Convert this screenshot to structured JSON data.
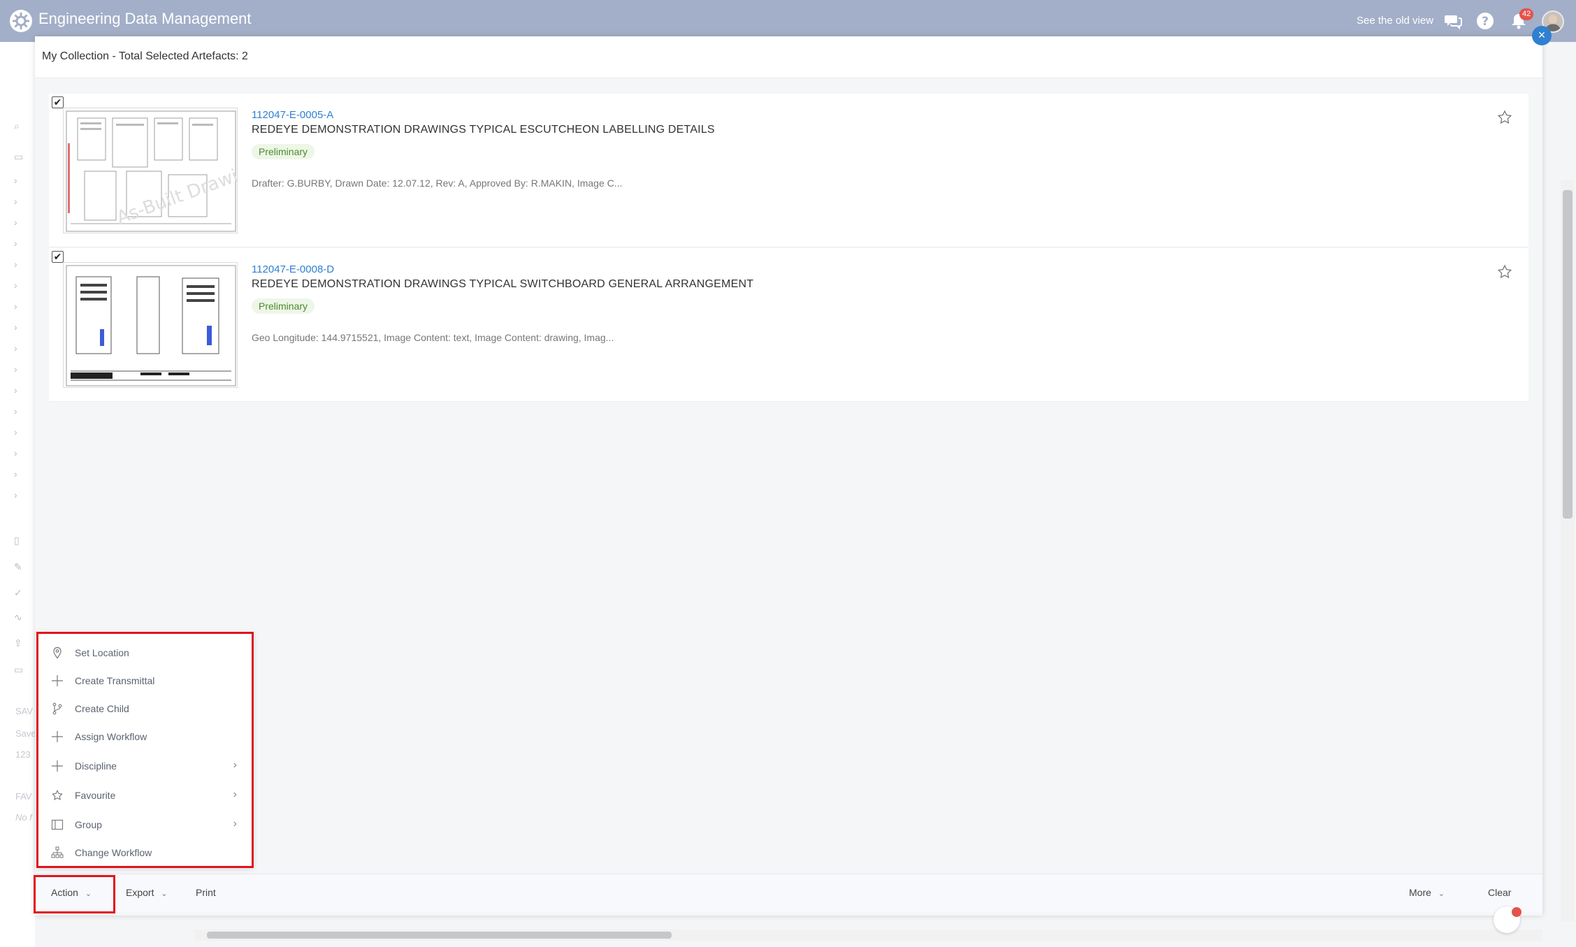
{
  "app": {
    "title": "Engineering Data Management",
    "old_view_link": "See the old view",
    "notification_count": "42"
  },
  "modal": {
    "title": "My Collection - Total Selected Artefacts: 2",
    "close_icon": "close-icon"
  },
  "artefacts": [
    {
      "id": "112047-E-0005-A",
      "title": "REDEYE DEMONSTRATION DRAWINGS TYPICAL ESCUTCHEON LABELLING DETAILS",
      "status": "Preliminary",
      "meta": "Drafter: G.BURBY, Drawn Date: 12.07.12, Rev: A, Approved By: R.MAKIN, Image C...",
      "checked": true
    },
    {
      "id": "112047-E-0008-D",
      "title": "REDEYE DEMONSTRATION DRAWINGS TYPICAL SWITCHBOARD GENERAL ARRANGEMENT",
      "status": "Preliminary",
      "meta": "Geo Longitude: 144.9715521, Image Content: text, Image Content: drawing, Imag...",
      "checked": true
    }
  ],
  "action_menu": {
    "items": [
      {
        "label": "Set Location",
        "icon": "location-pin-icon"
      },
      {
        "label": "Create Transmittal",
        "icon": "plus-icon"
      },
      {
        "label": "Create Child",
        "icon": "branch-icon"
      },
      {
        "label": "Assign Workflow",
        "icon": "plus-icon"
      },
      {
        "label": "Discipline",
        "icon": "plus-icon",
        "submenu": true
      },
      {
        "label": "Favourite",
        "icon": "star-icon",
        "submenu": true
      },
      {
        "label": "Group",
        "icon": "group-icon",
        "submenu": true
      },
      {
        "label": "Change Workflow",
        "icon": "hierarchy-icon"
      }
    ]
  },
  "toolbar": {
    "action": "Action",
    "export": "Export",
    "print": "Print",
    "more": "More",
    "clear": "Clear"
  },
  "background": {
    "rail_labels": [
      "SAV",
      "Save",
      "123",
      "FAV",
      "No f"
    ]
  },
  "colors": {
    "topbar": "#a3afc8",
    "link": "#2f80d1",
    "highlight": "#e0141b",
    "status_bg": "#eef6e8",
    "status_text": "#4a8a2a"
  }
}
